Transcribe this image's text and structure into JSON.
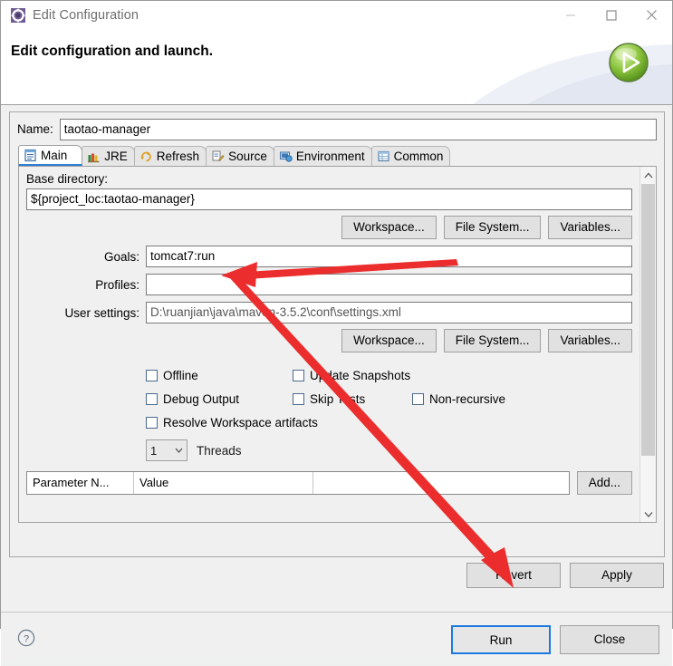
{
  "window": {
    "title": "Edit Configuration",
    "icon": "configuration-gear-icon",
    "controls": {
      "minimize": "minimize-icon",
      "maximize": "maximize-icon",
      "close": "close-icon"
    }
  },
  "banner": {
    "title": "Edit configuration and launch.",
    "badge_icon": "run-play-icon"
  },
  "name_field": {
    "label": "Name:",
    "value": "taotao-manager",
    "placeholder": ""
  },
  "tabs": [
    {
      "label": "Main",
      "icon": "main-document-icon",
      "selected": true
    },
    {
      "label": "JRE",
      "icon": "jre-books-icon",
      "selected": false
    },
    {
      "label": "Refresh",
      "icon": "refresh-arrows-icon",
      "selected": false
    },
    {
      "label": "Source",
      "icon": "source-pencil-icon",
      "selected": false
    },
    {
      "label": "Environment",
      "icon": "environment-monitor-icon",
      "selected": false
    },
    {
      "label": "Common",
      "icon": "common-table-icon",
      "selected": false
    }
  ],
  "main_tab": {
    "base_directory": {
      "label": "Base directory:",
      "value": "${project_loc:taotao-manager}"
    },
    "dir_buttons": [
      {
        "label": "Workspace..."
      },
      {
        "label": "File System..."
      },
      {
        "label": "Variables..."
      }
    ],
    "goals": {
      "label": "Goals:",
      "value": "tomcat7:run"
    },
    "profiles": {
      "label": "Profiles:",
      "value": ""
    },
    "user_settings": {
      "label": "User settings:",
      "value": "D:\\ruanjian\\java\\maven-3.5.2\\conf\\settings.xml"
    },
    "settings_buttons": [
      {
        "label": "Workspace..."
      },
      {
        "label": "File System..."
      },
      {
        "label": "Variables..."
      }
    ],
    "checkboxes": [
      {
        "label": "Offline",
        "checked": false
      },
      {
        "label": "Update Snapshots",
        "checked": false
      },
      {
        "label": "Debug Output",
        "checked": false
      },
      {
        "label": "Skip Tests",
        "checked": false
      },
      {
        "label": "Non-recursive",
        "checked": false
      },
      {
        "label": "Resolve Workspace artifacts",
        "checked": false
      }
    ],
    "threads": {
      "value": "1",
      "label": "Threads"
    },
    "parameter_table": {
      "columns": [
        "Parameter N...",
        "Value",
        ""
      ],
      "rows": [],
      "add_button": "Add..."
    }
  },
  "panel_buttons": [
    {
      "label": "Revert"
    },
    {
      "label": "Apply"
    }
  ],
  "footer": {
    "help_icon": "help-question-icon",
    "buttons": [
      {
        "label": "Run",
        "default": true
      },
      {
        "label": "Close",
        "default": false
      }
    ]
  },
  "annotations": {
    "arrow_color": "#ec2d2d",
    "arrows": [
      {
        "name": "arrow-to-goals-field",
        "target": "goals-input"
      },
      {
        "name": "arrow-to-run-button",
        "target": "run-button"
      }
    ]
  },
  "scrollbar": {
    "up_icon": "chevron-up-icon",
    "down_icon": "chevron-down-icon"
  }
}
